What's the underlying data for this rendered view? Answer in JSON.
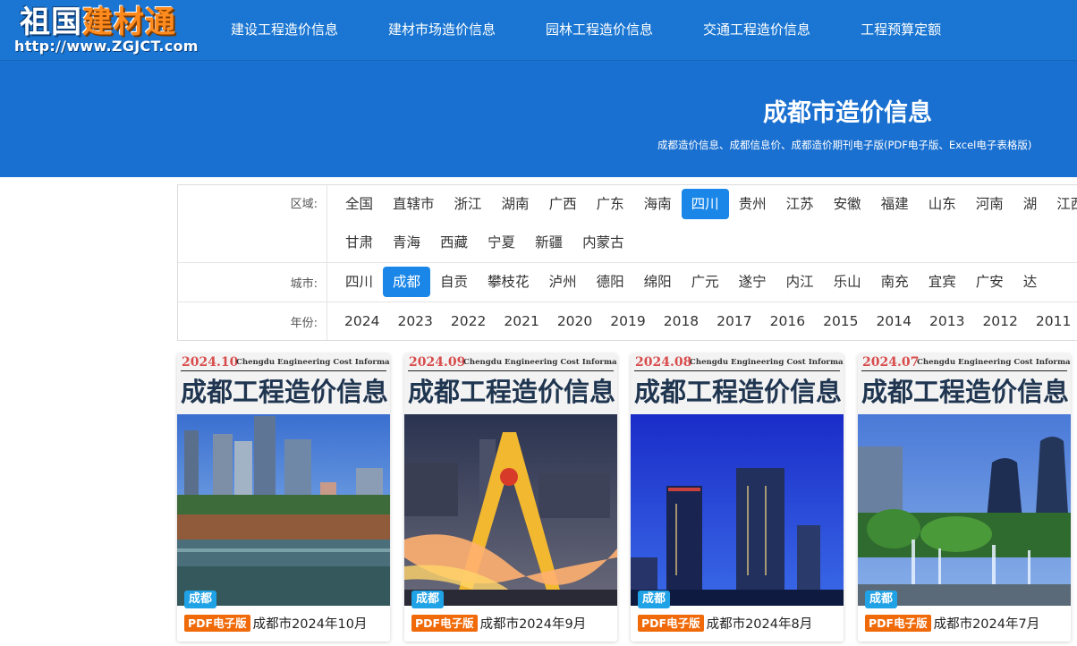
{
  "logo": {
    "part_white": "祖国",
    "part_orange": "建材通",
    "url": "http://www.ZGJCT.com"
  },
  "nav": [
    "建设工程造价信息",
    "建材市场造价信息",
    "园林工程造价信息",
    "交通工程造价信息",
    "工程预算定额"
  ],
  "banner": {
    "title": "成都市造价信息",
    "subtitle": "成都造价信息、成都信息价、成都造价期刊电子版(PDF电子版、Excel电子表格版)"
  },
  "filters": {
    "region": {
      "label": "区域:",
      "active": "四川",
      "options": [
        "全国",
        "直辖市",
        "浙江",
        "湖南",
        "广西",
        "广东",
        "海南",
        "四川",
        "贵州",
        "江苏",
        "安徽",
        "福建",
        "山东",
        "河南",
        "湖",
        "江西",
        "甘肃",
        "青海",
        "西藏",
        "宁夏",
        "新疆",
        "内蒙古"
      ]
    },
    "city": {
      "label": "城市:",
      "active": "成都",
      "options": [
        "四川",
        "成都",
        "自贡",
        "攀枝花",
        "泸州",
        "德阳",
        "绵阳",
        "广元",
        "遂宁",
        "内江",
        "乐山",
        "南充",
        "宜宾",
        "广安",
        "达"
      ]
    },
    "year": {
      "label": "年份:",
      "options": [
        "2024",
        "2023",
        "2022",
        "2021",
        "2020",
        "2019",
        "2018",
        "2017",
        "2016",
        "2015",
        "2014",
        "2013",
        "2012",
        "2011"
      ]
    }
  },
  "cards": [
    {
      "date": "2024.10",
      "en": "Chengdu Engineering Cost Information",
      "cn": "成都工程造价信息",
      "city": "成都",
      "tag": "PDF电子版",
      "title": "成都市2024年10月"
    },
    {
      "date": "2024.09",
      "en": "Chengdu Engineering Cost Information",
      "cn": "成都工程造价信息",
      "city": "成都",
      "tag": "PDF电子版",
      "title": "成都市2024年9月"
    },
    {
      "date": "2024.08",
      "en": "Chengdu Engineering Cost Information",
      "cn": "成都工程造价信息",
      "city": "成都",
      "tag": "PDF电子版",
      "title": "成都市2024年8月"
    },
    {
      "date": "2024.07",
      "en": "Chengdu Engineering Cost Information",
      "cn": "成都工程造价信息",
      "city": "成都",
      "tag": "PDF电子版",
      "title": "成都市2024年7月"
    }
  ],
  "colors": {
    "header_blue": "#1a76d2",
    "active_blue": "#1a86e8",
    "pdf_orange": "#f06a0a",
    "city_tag": "#20a2e6"
  }
}
